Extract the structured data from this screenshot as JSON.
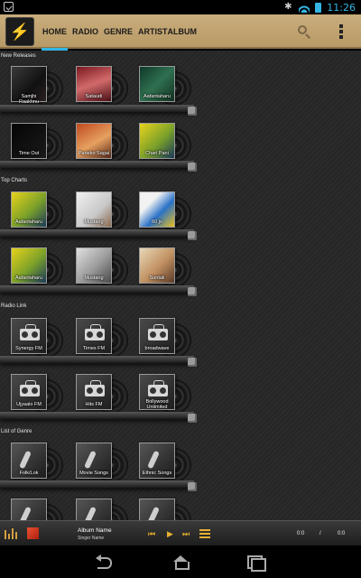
{
  "status_bar": {
    "time": "11:26"
  },
  "app": {
    "logo_icon": "lightning-bolt-icon"
  },
  "tabs": [
    {
      "label": "HOME",
      "active": true
    },
    {
      "label": "RADIO",
      "active": false
    },
    {
      "label": "GENRE",
      "active": false
    },
    {
      "label": "ARTIST",
      "active": false
    },
    {
      "label": "ALBUM",
      "active": false
    }
  ],
  "sections": {
    "new_releases": {
      "title": "New Releases",
      "rows": [
        [
          {
            "label": "Samjhi Raakhnu",
            "art": "art-dark"
          },
          {
            "label": "Sataudi",
            "art": "art-red"
          },
          {
            "label": "Aafantaharu",
            "art": "art-green"
          }
        ],
        [
          {
            "label": "Time Out",
            "art": "art-black"
          },
          {
            "label": "Paneko Sagai",
            "art": "art-orange"
          },
          {
            "label": "Chari Pani",
            "art": "art-yellow"
          }
        ]
      ]
    },
    "top_charts": {
      "title": "Top Charts",
      "rows": [
        [
          {
            "label": "Aafantaharu",
            "art": "art-yellow"
          },
          {
            "label": "Mustang",
            "art": "art-white"
          },
          {
            "label": "60 jo",
            "art": "art-blue"
          }
        ],
        [
          {
            "label": "Aafantaharu",
            "art": "art-yellow"
          },
          {
            "label": "Mustang",
            "art": "art-silver"
          },
          {
            "label": "Suntali",
            "art": "art-brown"
          }
        ]
      ]
    },
    "radio_link": {
      "title": "Radio Link",
      "rows": [
        [
          {
            "label": "Synergy FM",
            "art": "art-radio"
          },
          {
            "label": "Times FM",
            "art": "art-radio"
          },
          {
            "label": "broadwave",
            "art": "art-radio"
          }
        ],
        [
          {
            "label": "Ujyaalo FM",
            "art": "art-radio"
          },
          {
            "label": "Hits FM",
            "art": "art-radio"
          },
          {
            "label": "Bollywood Unlimited",
            "art": "art-radio"
          }
        ]
      ]
    },
    "list_of_genre": {
      "title": "List of Genre",
      "rows": [
        [
          {
            "label": "Folk/Lok",
            "art": "art-mic"
          },
          {
            "label": "Movie Songs",
            "art": "art-mic"
          },
          {
            "label": "Ethnic Songs",
            "art": "art-mic"
          }
        ],
        [
          {
            "label": "",
            "art": "art-mic"
          },
          {
            "label": "",
            "art": "art-mic"
          },
          {
            "label": "",
            "art": "art-mic"
          }
        ]
      ]
    }
  },
  "player": {
    "album_name": "Album Name",
    "singer_name": "Singer Name",
    "current_time": "0:0",
    "separator": "/",
    "total_time": "0:0"
  },
  "colors": {
    "accent": "#33b5e5",
    "action_bar": "#c2a572",
    "player_controls": "#e8b030"
  }
}
